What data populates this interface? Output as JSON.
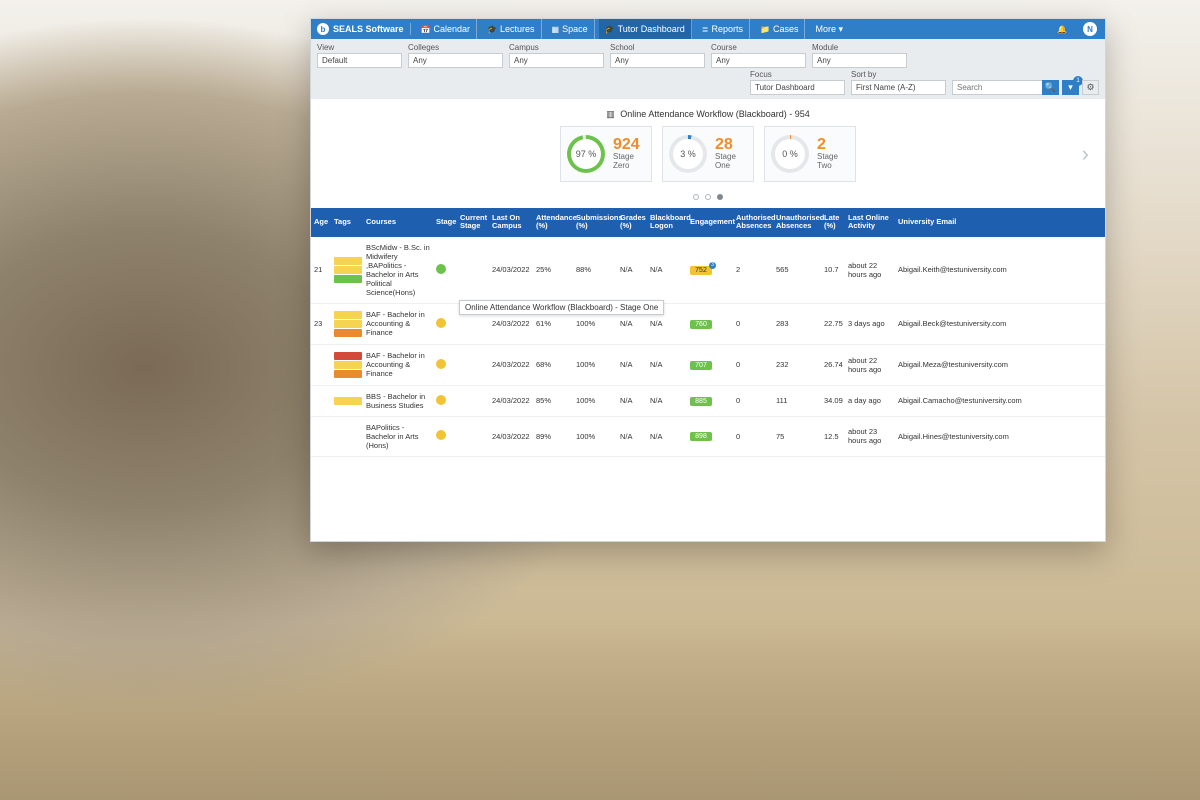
{
  "brand": {
    "logo_letter": "b",
    "name": "SEALS Software"
  },
  "nav": {
    "items": [
      {
        "icon": "📅",
        "label": "Calendar"
      },
      {
        "icon": "🎓",
        "label": "Lectures"
      },
      {
        "icon": "▦",
        "label": "Space"
      },
      {
        "icon": "🎓",
        "label": "Tutor Dashboard",
        "active": true
      },
      {
        "icon": "≣",
        "label": "Reports"
      },
      {
        "icon": "📁",
        "label": "Cases"
      },
      {
        "icon": "",
        "label": "More ▾"
      }
    ],
    "bell": "🔔",
    "avatar_initial": "N"
  },
  "filters": {
    "row1": [
      {
        "label": "View",
        "value": "Default"
      },
      {
        "label": "Colleges",
        "value": "Any"
      },
      {
        "label": "Campus",
        "value": "Any"
      },
      {
        "label": "School",
        "value": "Any"
      },
      {
        "label": "Course",
        "value": "Any"
      },
      {
        "label": "Module",
        "value": "Any"
      }
    ],
    "row2": {
      "focus": {
        "label": "Focus",
        "value": "Tutor Dashboard"
      },
      "sort": {
        "label": "Sort by",
        "value": "First Name (A-Z)"
      },
      "search_placeholder": "Search",
      "filter_badge": "1"
    }
  },
  "workflow": {
    "title": "Online Attendance Workflow (Blackboard) - 954",
    "pager_tooltip": "Online Attendance Workflow (Blackboard) - Stage One",
    "stages": [
      {
        "pct": "97 %",
        "count": "924",
        "name": "Stage Zero",
        "ring": "g"
      },
      {
        "pct": "3 %",
        "count": "28",
        "name": "Stage One",
        "ring": "b"
      },
      {
        "pct": "0 %",
        "count": "2",
        "name": "Stage Two",
        "ring": "o"
      }
    ]
  },
  "columns": [
    "Age",
    "Tags",
    "Courses",
    "Stage",
    "Current Stage",
    "Last On Campus",
    "Attendance (%)",
    "Submissions (%)",
    "Grades (%)",
    "Blackboard Logon",
    "Engagement",
    "Authorised Absences",
    "Unauthorised Absences",
    "Late (%)",
    "Last Online Activity",
    "University Email"
  ],
  "rows": [
    {
      "age": "21",
      "tags": [
        "tc-y",
        "tc-y",
        "tc-g"
      ],
      "course": "BScMidw - B.Sc. in Midwifery ,BAPolitics - Bachelor in Arts Political Science(Hons)",
      "stage_class": "sp-green",
      "current_stage": "",
      "last_on": "24/03/2022",
      "attendance": "25%",
      "submissions": "88%",
      "grades": "N/A",
      "bb": "N/A",
      "eng_val": "752",
      "eng_class": "amber",
      "eng_badge": "3",
      "auth": "2",
      "unauth": "565",
      "late": "10.7",
      "last_online": "about 22 hours ago",
      "email": "Abigail.Keith@testuniversity.com"
    },
    {
      "age": "23",
      "tags": [
        "tc-y",
        "tc-y",
        "tc-o"
      ],
      "course": "BAF - Bachelor in Accounting & Finance",
      "stage_class": "sp-amber",
      "current_stage": "",
      "last_on": "24/03/2022",
      "attendance": "61%",
      "submissions": "100%",
      "grades": "N/A",
      "bb": "N/A",
      "eng_val": "760",
      "eng_class": "green",
      "auth": "0",
      "unauth": "283",
      "late": "22.75",
      "last_online": "3 days ago",
      "email": "Abigail.Beck@testuniversity.com"
    },
    {
      "age": "",
      "tags": [
        "tc-r",
        "tc-y",
        "tc-o"
      ],
      "course": "BAF - Bachelor in Accounting & Finance",
      "stage_class": "sp-amber",
      "current_stage": "",
      "last_on": "24/03/2022",
      "attendance": "68%",
      "submissions": "100%",
      "grades": "N/A",
      "bb": "N/A",
      "eng_val": "707",
      "eng_class": "green",
      "auth": "0",
      "unauth": "232",
      "late": "26.74",
      "last_online": "about 22 hours ago",
      "email": "Abigail.Meza@testuniversity.com"
    },
    {
      "age": "",
      "tags": [
        "tc-y"
      ],
      "course": "BBS - Bachelor in Business Studies",
      "stage_class": "sp-amber",
      "current_stage": "",
      "last_on": "24/03/2022",
      "attendance": "85%",
      "submissions": "100%",
      "grades": "N/A",
      "bb": "N/A",
      "eng_val": "885",
      "eng_class": "green",
      "auth": "0",
      "unauth": "111",
      "late": "34.09",
      "last_online": "a day ago",
      "email": "Abigail.Camacho@testuniversity.com"
    },
    {
      "age": "",
      "tags": [],
      "course": "BAPolitics - Bachelor in Arts (Hons)",
      "stage_class": "sp-amber",
      "current_stage": "",
      "last_on": "24/03/2022",
      "attendance": "89%",
      "submissions": "100%",
      "grades": "N/A",
      "bb": "N/A",
      "eng_val": "898",
      "eng_class": "green",
      "auth": "0",
      "unauth": "75",
      "late": "12.5",
      "last_online": "about 23 hours ago",
      "email": "Abigail.Hines@testuniversity.com"
    }
  ]
}
